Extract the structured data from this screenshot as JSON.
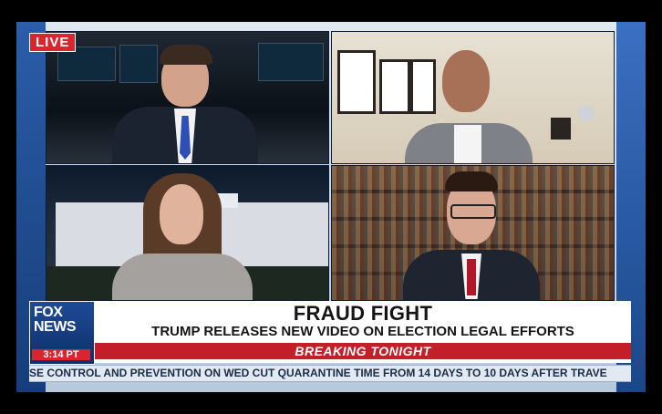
{
  "live_badge": "LIVE",
  "network": {
    "logo_line1": "FOX",
    "logo_line2": "NEWS",
    "time": "3:14 PT"
  },
  "chyron": {
    "headline": "FRAUD FIGHT",
    "subheadline": "TRUMP RELEASES NEW VIDEO ON ELECTION LEGAL EFFORTS",
    "banner": "BREAKING TONIGHT"
  },
  "ticker": {
    "text": "SE CONTROL AND PREVENTION ON WED CUT QUARANTINE TIME FROM 14 DAYS TO 10 DAYS AFTER TRAVE"
  },
  "colors": {
    "brand_blue": "#163d7a",
    "alert_red": "#d8262e"
  }
}
